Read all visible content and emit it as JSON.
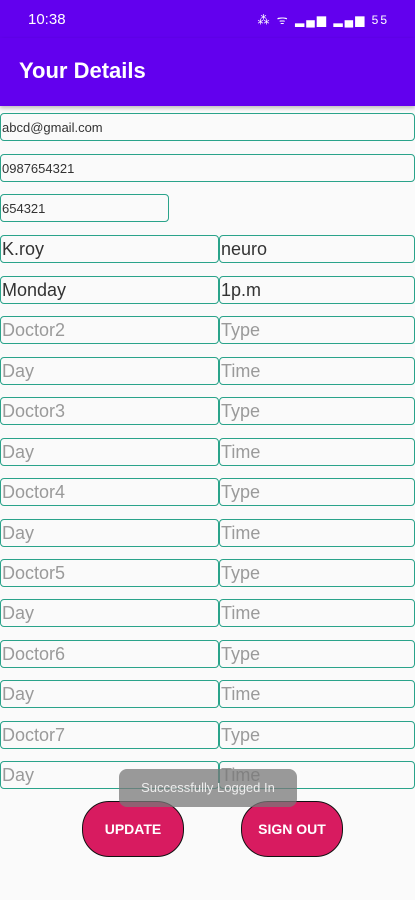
{
  "status_bar": {
    "time": "10:38",
    "icons": "⁂ ᯤ ▂▄▆ ▂▄▆ 55"
  },
  "app_bar": {
    "title": "Your Details"
  },
  "fields": {
    "email": "abcd@gmail.com",
    "phone": "0987654321",
    "password": "654321",
    "doctor1": "K.roy",
    "type1": "neuro",
    "day1": "Monday",
    "time1": "1p.m",
    "doctor2_placeholder": "Doctor2",
    "type2_placeholder": "Type",
    "day2_placeholder": "Day",
    "time2_placeholder": "Time",
    "doctor3_placeholder": "Doctor3",
    "type3_placeholder": "Type",
    "day3_placeholder": "Day",
    "time3_placeholder": "Time",
    "doctor4_placeholder": "Doctor4",
    "type4_placeholder": "Type",
    "day4_placeholder": "Day",
    "time4_placeholder": "Time",
    "doctor5_placeholder": "Doctor5",
    "type5_placeholder": "Type",
    "day5_placeholder": "Day",
    "time5_placeholder": "Time",
    "doctor6_placeholder": "Doctor6",
    "type6_placeholder": "Type",
    "day6_placeholder": "Day",
    "time6_placeholder": "Time",
    "doctor7_placeholder": "Doctor7",
    "type7_placeholder": "Type",
    "day7_placeholder": "Day",
    "time7_placeholder": "Time"
  },
  "buttons": {
    "update": "UPDATE",
    "sign_out": "SIGN OUT"
  },
  "toast": "Successfully Logged In"
}
